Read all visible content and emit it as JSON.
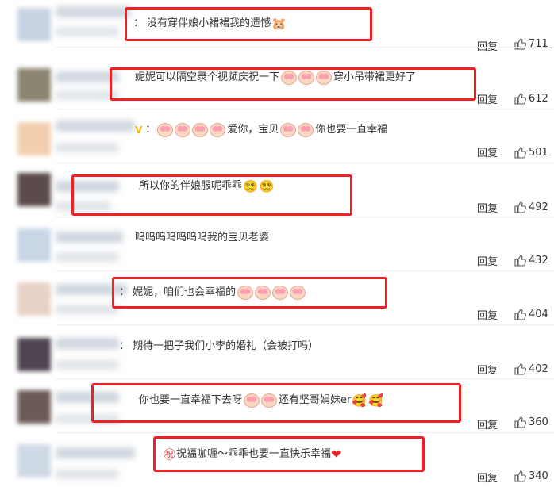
{
  "comments": [
    {
      "text_before": "：  没有穿伴娘小裙裙我的遗憾",
      "text_after": "",
      "replies_label": "回复",
      "likes": "711",
      "emoji": "🐹",
      "stickers": 0
    },
    {
      "text_before": "妮妮可以隔空录个视频庆祝一下",
      "text_after": "穿小吊带裙更好了",
      "replies_label": "回复",
      "likes": "612",
      "stickers": 3
    },
    {
      "text_before": "",
      "text_mid": "爱你，宝贝",
      "text_after": "你也要一直幸福",
      "replies_label": "回复",
      "likes": "501",
      "stickers_before": 4,
      "stickers_mid": 2
    },
    {
      "text_before": "所以你的伴娘服呢乖乖",
      "replies_label": "回复",
      "likes": "492",
      "emoji": "😵‍💫"
    },
    {
      "text_before": "呜呜呜呜呜呜呜我的宝贝老婆",
      "replies_label": "回复",
      "likes": "432"
    },
    {
      "text_before": "：  妮妮，咱们也会幸福的",
      "replies_label": "回复",
      "likes": "404",
      "stickers": 4
    },
    {
      "text_before": "：  期待一把子我们小李的婚礼（会被打吗）",
      "replies_label": "回复",
      "likes": "402"
    },
    {
      "text_before": "你也要一直幸福下去呀",
      "text_after": "还有坚哥娟妹er",
      "replies_label": "回复",
      "likes": "360",
      "stickers": 2,
      "emoji": "🥰"
    },
    {
      "text_before": "祝福咖喱～乖乖也要一直快乐幸福",
      "replies_label": "回复",
      "likes": "340",
      "emoji": "❤"
    }
  ],
  "colors": {
    "highlight": "#f41e24",
    "text": "#333333",
    "divider": "#eeeeee"
  }
}
